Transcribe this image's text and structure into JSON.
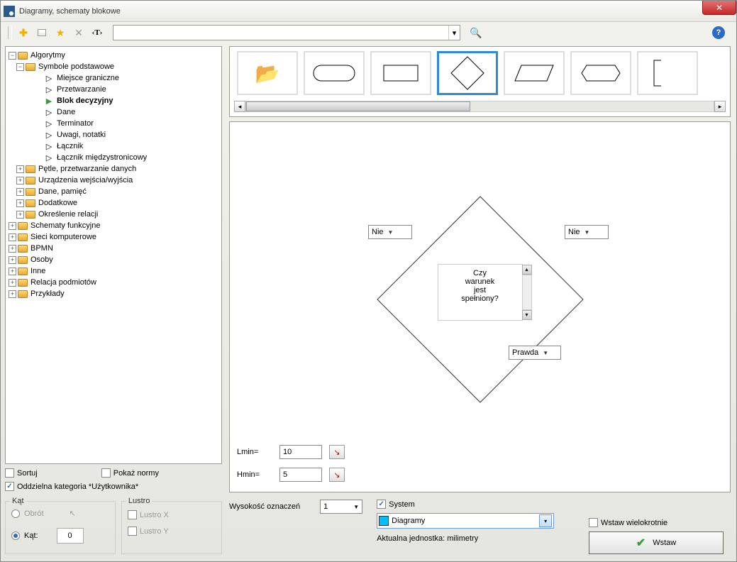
{
  "window": {
    "title": "Diagramy, schematy blokowe"
  },
  "toolbar": {
    "search_value": "",
    "help": "?"
  },
  "tree": {
    "root": "Algorytmy",
    "basic": "Symbole podstawowe",
    "items_basic": [
      "Miejsce graniczne",
      "Przetwarzanie",
      "Blok decyzyjny",
      "Dane",
      "Terminator",
      "Uwagi, notatki",
      "Łącznik",
      "Łącznik międzystronicowy"
    ],
    "folders_alg": [
      "Pętle, przetwarzanie danych",
      "Urządzenia wejścia/wyjścia",
      "Dane, pamięć",
      "Dodatkowe",
      "Określenie relacji"
    ],
    "folders_root": [
      "Schematy funkcyjne",
      "Sieci komputerowe",
      "BPMN",
      "Osoby",
      "Inne",
      "Relacja podmiotów",
      "Przykłady"
    ]
  },
  "options": {
    "sort": "Sortuj",
    "show_norms": "Pokaż normy",
    "user_category": "Oddzielna kategoria *Użytkownika*",
    "angle_legend": "Kąt",
    "rotation": "Obrót",
    "angle": "Kąt:",
    "angle_value": "0",
    "mirror_legend": "Lustro",
    "mirror_x": "Lustro X",
    "mirror_y": "Lustro Y"
  },
  "preview": {
    "decision_text": "Czy\nwarunek\njest\nspełniony?",
    "left_sel": "Nie",
    "right_sel": "Nie",
    "bottom_sel": "Prawda",
    "lmin_label": "Lmin=",
    "lmin_value": "10",
    "hmin_label": "Hmin=",
    "hmin_value": "5"
  },
  "bottom": {
    "marker_height_label": "Wysokość oznaczeń",
    "marker_height_value": "1",
    "system_label": "System",
    "system_value": "Diagramy",
    "unit_label": "Aktualna jednostka: milimetry",
    "insert_multi": "Wstaw wielokrotnie",
    "insert": "Wstaw"
  }
}
